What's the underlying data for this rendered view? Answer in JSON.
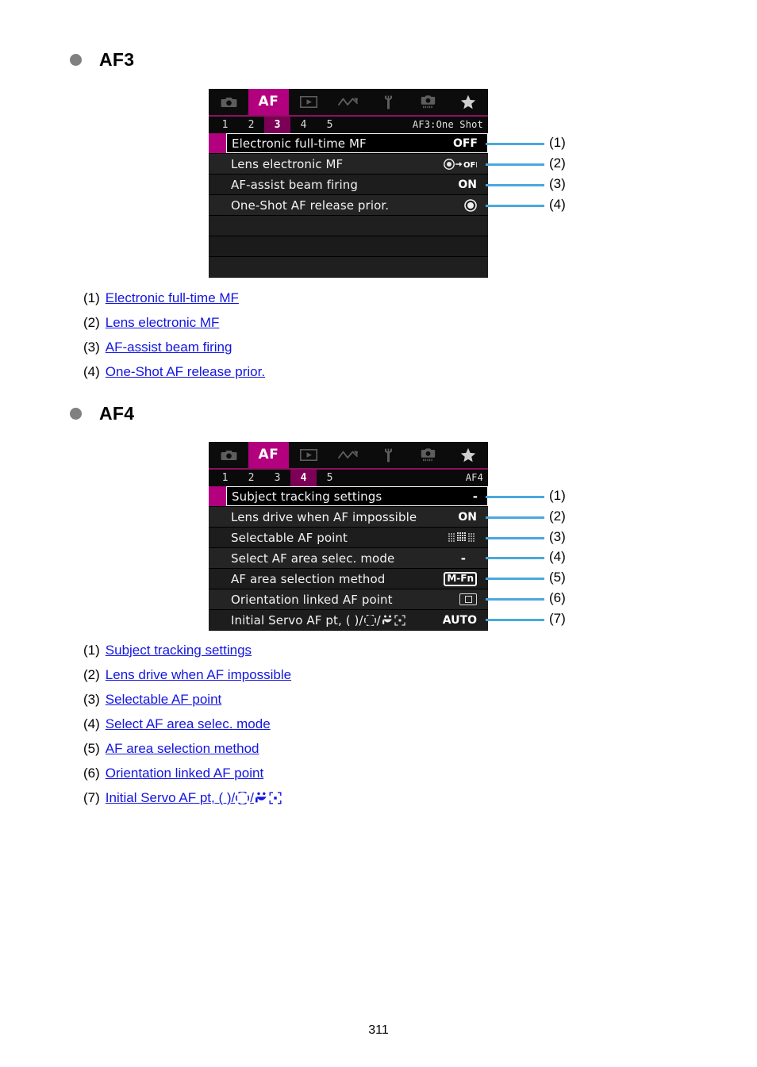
{
  "page": {
    "number": "311"
  },
  "sections": [
    {
      "id": "af3",
      "title": "AF3",
      "bullet_color": "#808080",
      "screen": {
        "tabs": [
          {
            "name": "shooting-tab",
            "icon": "camera-icon",
            "active": false
          },
          {
            "name": "af-tab",
            "icon": "af-text",
            "label": "AF",
            "active": true
          },
          {
            "name": "playback-tab",
            "icon": "playback-icon",
            "active": false
          },
          {
            "name": "network-tab",
            "icon": "wireless-icon",
            "active": false
          },
          {
            "name": "setup-tab",
            "icon": "wrench-icon",
            "active": false
          },
          {
            "name": "custom-functions-tab",
            "icon": "custom-camera-icon",
            "active": false
          },
          {
            "name": "my-menu-tab",
            "icon": "star-icon",
            "active": false
          }
        ],
        "pages": [
          "1",
          "2",
          "3",
          "4",
          "5"
        ],
        "active_page": "3",
        "status_right": "AF3:One Shot",
        "rows": [
          {
            "label": "Electronic full-time MF",
            "value": "OFF",
            "value_type": "text",
            "selected": true
          },
          {
            "label": "Lens electronic MF",
            "value": "●→OFF",
            "value_type": "lens-mf-off-icon",
            "selected": false
          },
          {
            "label": "AF-assist beam firing",
            "value": "ON",
            "value_type": "text",
            "selected": false
          },
          {
            "label": "One-Shot AF release prior.",
            "value": "",
            "value_type": "focus-priority-icon",
            "selected": false
          }
        ],
        "empty_rows": 3
      },
      "callouts": [
        "(1)",
        "(2)",
        "(3)",
        "(4)"
      ],
      "legend": [
        {
          "num": "(1)",
          "text": "Electronic full-time MF"
        },
        {
          "num": "(2)",
          "text": "Lens electronic MF"
        },
        {
          "num": "(3)",
          "text": "AF-assist beam firing"
        },
        {
          "num": "(4)",
          "text": "One-Shot AF release prior."
        }
      ]
    },
    {
      "id": "af4",
      "title": "AF4",
      "bullet_color": "#808080",
      "screen": {
        "tabs": [
          {
            "name": "shooting-tab",
            "icon": "camera-icon",
            "active": false
          },
          {
            "name": "af-tab",
            "icon": "af-text",
            "label": "AF",
            "active": true
          },
          {
            "name": "playback-tab",
            "icon": "playback-icon",
            "active": false
          },
          {
            "name": "network-tab",
            "icon": "wireless-icon",
            "active": false
          },
          {
            "name": "setup-tab",
            "icon": "wrench-icon",
            "active": false
          },
          {
            "name": "custom-functions-tab",
            "icon": "custom-camera-icon",
            "active": false
          },
          {
            "name": "my-menu-tab",
            "icon": "star-icon",
            "active": false
          }
        ],
        "pages": [
          "1",
          "2",
          "3",
          "4",
          "5"
        ],
        "active_page": "4",
        "status_right": "AF4",
        "rows": [
          {
            "label": "Subject tracking settings",
            "value": "-",
            "value_type": "dash",
            "selected": true
          },
          {
            "label": "Lens drive when AF impossible",
            "value": "ON",
            "value_type": "text",
            "selected": false
          },
          {
            "label": "Selectable AF point",
            "value": "",
            "value_type": "af-point-grid-icon",
            "selected": false
          },
          {
            "label": "Select AF area selec. mode",
            "value": "-",
            "value_type": "dash",
            "selected": false
          },
          {
            "label": "AF area selection method",
            "value": "M-Fn",
            "value_type": "mfn-chip",
            "selected": false
          },
          {
            "label": "Orientation linked AF point",
            "value": "",
            "value_type": "orientation-box-icon",
            "selected": false
          },
          {
            "label": "Initial Servo AF pt, ( )/",
            "value": "AUTO",
            "value_type": "text",
            "selected": false,
            "label_icons": [
              "tracking-frame-icon",
              "face-tracking-icon",
              "expand-frame-icon"
            ]
          }
        ],
        "empty_rows": 0
      },
      "callouts": [
        "(1)",
        "(2)",
        "(3)",
        "(4)",
        "(5)",
        "(6)",
        "(7)"
      ],
      "legend": [
        {
          "num": "(1)",
          "text": "Subject tracking settings"
        },
        {
          "num": "(2)",
          "text": "Lens drive when AF impossible"
        },
        {
          "num": "(3)",
          "text": "Selectable AF point"
        },
        {
          "num": "(4)",
          "text": "Select AF area selec. mode"
        },
        {
          "num": "(5)",
          "text": "AF area selection method"
        },
        {
          "num": "(6)",
          "text": "Orientation linked AF point"
        },
        {
          "num": "(7)",
          "text": "Initial Servo AF pt, ( )/"
        }
      ]
    }
  ],
  "colors": {
    "accent_magenta": "#b2007f",
    "callout_blue": "#4aa8dd",
    "link_blue": "#1316e0",
    "screen_bg": "#000000"
  }
}
